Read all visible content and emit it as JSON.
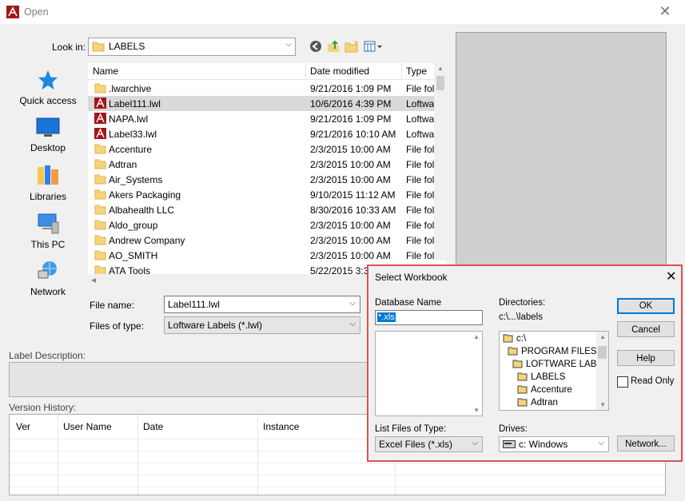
{
  "window": {
    "title": "Open"
  },
  "lookin": {
    "label": "Look in:",
    "value": "LABELS"
  },
  "places": [
    {
      "label": "Quick access",
      "icon": "star-icon"
    },
    {
      "label": "Desktop",
      "icon": "desktop-icon"
    },
    {
      "label": "Libraries",
      "icon": "libraries-icon"
    },
    {
      "label": "This PC",
      "icon": "computer-icon"
    },
    {
      "label": "Network",
      "icon": "network-icon"
    }
  ],
  "filelist": {
    "columns": [
      "Name",
      "Date modified",
      "Type"
    ],
    "rows": [
      {
        "name": ".lwarchive",
        "date": "9/21/2016 1:09 PM",
        "type": "File fol",
        "icon": "folder-icon"
      },
      {
        "name": "Label111.lwl",
        "date": "10/6/2016 4:39 PM",
        "type": "Loftwa",
        "icon": "loftware-file-icon",
        "selected": true
      },
      {
        "name": "NAPA.lwl",
        "date": "9/21/2016 1:09 PM",
        "type": "Loftwa",
        "icon": "loftware-file-icon"
      },
      {
        "name": "Label33.lwl",
        "date": "9/21/2016 10:10 AM",
        "type": "Loftwa",
        "icon": "loftware-file-icon"
      },
      {
        "name": "Accenture",
        "date": "2/3/2015 10:00 AM",
        "type": "File fol",
        "icon": "folder-icon"
      },
      {
        "name": "Adtran",
        "date": "2/3/2015 10:00 AM",
        "type": "File fol",
        "icon": "folder-icon"
      },
      {
        "name": "Air_Systems",
        "date": "2/3/2015 10:00 AM",
        "type": "File fol",
        "icon": "folder-icon"
      },
      {
        "name": "Akers Packaging",
        "date": "9/10/2015 11:12 AM",
        "type": "File fol",
        "icon": "folder-icon"
      },
      {
        "name": "Albahealth LLC",
        "date": "8/30/2016 10:33 AM",
        "type": "File fol",
        "icon": "folder-icon"
      },
      {
        "name": "Aldo_group",
        "date": "2/3/2015 10:00 AM",
        "type": "File fol",
        "icon": "folder-icon"
      },
      {
        "name": "Andrew Company",
        "date": "2/3/2015 10:00 AM",
        "type": "File fol",
        "icon": "folder-icon"
      },
      {
        "name": "AO_SMITH",
        "date": "2/3/2015 10:00 AM",
        "type": "File fol",
        "icon": "folder-icon"
      },
      {
        "name": "ATA Tools",
        "date": "5/22/2015 3:3",
        "type": "",
        "icon": "folder-icon"
      }
    ]
  },
  "filename": {
    "label": "File name:",
    "value": "Label111.lwl"
  },
  "filetype": {
    "label": "Files of type:",
    "value": "Loftware Labels (*.lwl)"
  },
  "description": {
    "label": "Label Description:"
  },
  "version": {
    "label": "Version History:",
    "columns": [
      "Ver",
      "User Name",
      "Date",
      "Instance"
    ]
  },
  "dialog": {
    "title": "Select Workbook",
    "db_label": "Database Name",
    "db_value": "*.xls",
    "list_type_label": "List Files of Type:",
    "list_type_value": "Excel Files (*.xls)",
    "dir_label": "Directories:",
    "dir_path": "c:\\...\\labels",
    "dirs": [
      "c:\\",
      "PROGRAM FILES",
      "LOFTWARE LABI",
      "LABELS",
      "Accenture",
      "Adtran"
    ],
    "drives_label": "Drives:",
    "drives_value": "c: Windows",
    "ok": "OK",
    "cancel": "Cancel",
    "help": "Help",
    "read_only": "Read Only",
    "network": "Network..."
  },
  "colors": {
    "accent": "#0078d7",
    "highlight_border": "#d9534f",
    "folder": "#f5d47a"
  }
}
